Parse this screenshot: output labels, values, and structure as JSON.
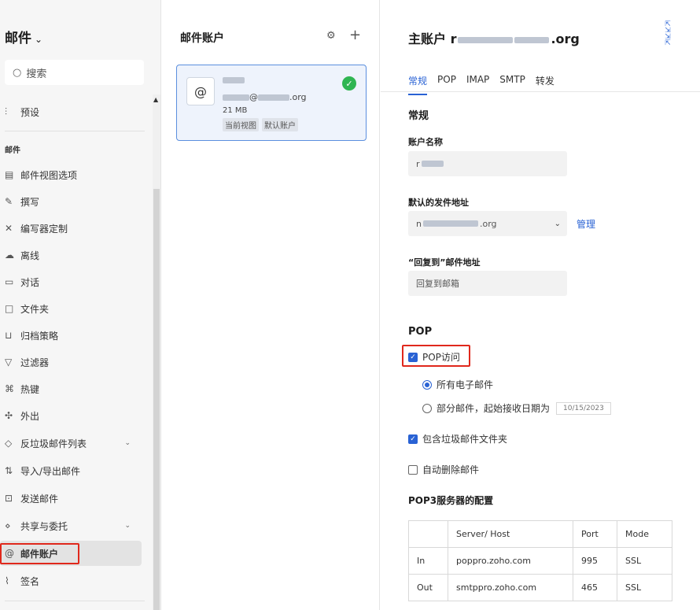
{
  "sidebar": {
    "title": "邮件",
    "search_placeholder": "搜索",
    "preset_label": "预设",
    "section_label": "邮件",
    "items": [
      {
        "label": "邮件视图选项",
        "icon": "layout-icon"
      },
      {
        "label": "撰写",
        "icon": "compose-icon"
      },
      {
        "label": "编写器定制",
        "icon": "tools-icon"
      },
      {
        "label": "离线",
        "icon": "offline-icon"
      },
      {
        "label": "对话",
        "icon": "chat-icon"
      },
      {
        "label": "文件夹",
        "icon": "folder-icon"
      },
      {
        "label": "归档策略",
        "icon": "archive-icon"
      },
      {
        "label": "过滤器",
        "icon": "filter-icon"
      },
      {
        "label": "热键",
        "icon": "hotkey-icon"
      },
      {
        "label": "外出",
        "icon": "away-icon"
      },
      {
        "label": "反垃圾邮件列表",
        "icon": "shield-icon"
      },
      {
        "label": "导入/导出邮件",
        "icon": "import-export-icon"
      },
      {
        "label": "发送邮件",
        "icon": "send-icon"
      },
      {
        "label": "共享与委托",
        "icon": "share-icon"
      },
      {
        "label": "邮件账户",
        "icon": "at-icon"
      },
      {
        "label": "签名",
        "icon": "signature-icon"
      }
    ]
  },
  "accounts": {
    "title": "邮件账户",
    "card": {
      "email_partial": "@",
      "email_domain": ".org",
      "size": "21 MB",
      "tags": [
        "当前视图",
        "默认账户"
      ]
    }
  },
  "detail": {
    "title_prefix": "主账户 r",
    "title_suffix": ".org",
    "tabs": [
      "常规",
      "POP",
      "IMAP",
      "SMTP",
      "转发"
    ],
    "general_title": "常规",
    "account_name_label": "账户名称",
    "account_name_value": "r",
    "default_from_label": "默认的发件地址",
    "default_from_value_prefix": "n",
    "default_from_value_suffix": ".org",
    "manage_link": "管理",
    "reply_to_label": "“回复到”邮件地址",
    "reply_to_placeholder": "回复到邮箱",
    "pop_title": "POP",
    "pop_access_label": "POP访问",
    "pop_access_checked": true,
    "radio_all": "所有电子邮件",
    "radio_partial": "部分邮件，起始接收日期为",
    "radio_partial_date": "10/15/2023",
    "include_spam_label": "包含垃圾邮件文件夹",
    "include_spam_checked": true,
    "auto_delete_label": "自动删除邮件",
    "auto_delete_checked": false,
    "pop3_config_title": "POP3服务器的配置",
    "table": {
      "headers": [
        "",
        "Server/ Host",
        "Port",
        "Mode"
      ],
      "rows": [
        [
          "In",
          "poppro.zoho.com",
          "995",
          "SSL"
        ],
        [
          "Out",
          "smtppro.zoho.com",
          "465",
          "SSL"
        ]
      ]
    }
  },
  "colors": {
    "accent": "#2962d4",
    "highlight": "#e0281c",
    "success": "#2fb552"
  }
}
